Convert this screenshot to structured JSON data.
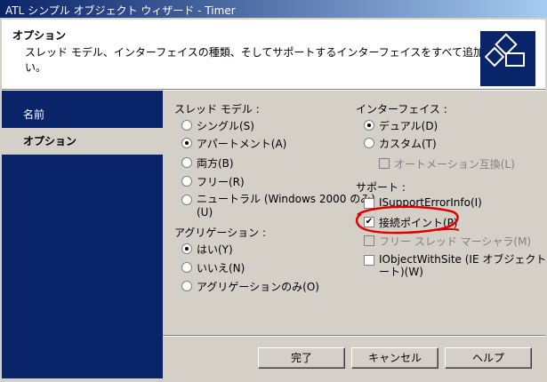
{
  "window": {
    "title": "ATL シンプル オブジェクト ウィザード - Timer"
  },
  "header": {
    "title": "オプション",
    "description": "スレッド モデル、インターフェイスの種類、そしてサポートするインターフェイスをすべて追加してください。"
  },
  "sidebar": {
    "items": [
      {
        "label": "名前",
        "active": false
      },
      {
        "label": "オプション",
        "active": true
      }
    ]
  },
  "threading": {
    "label": "スレッド モデル :",
    "options": [
      {
        "label": "シングル(S)",
        "selected": false
      },
      {
        "label": "アパートメント(A)",
        "selected": true
      },
      {
        "label": "両方(B)",
        "selected": false
      },
      {
        "label": "フリー(R)",
        "selected": false
      },
      {
        "label": "ニュートラル (Windows 2000 のみ)",
        "label2": "(U)",
        "selected": false
      }
    ]
  },
  "aggregation": {
    "label": "アグリゲーション :",
    "options": [
      {
        "label": "はい(Y)",
        "selected": true
      },
      {
        "label": "いいえ(N)",
        "selected": false
      },
      {
        "label": "アグリゲーションのみ(O)",
        "selected": false
      }
    ]
  },
  "interface": {
    "label": "インターフェイス :",
    "options": [
      {
        "label": "デュアル(D)",
        "selected": true
      },
      {
        "label": "カスタム(T)",
        "selected": false
      }
    ],
    "automation_compat": {
      "label": "オートメーション互換(L)",
      "checked": false,
      "enabled": false
    }
  },
  "support": {
    "label": "サポート :",
    "items": [
      {
        "label": "ISupportErrorInfo(I)",
        "checked": false,
        "enabled": true
      },
      {
        "label": "接続ポイント(P)",
        "checked": true,
        "enabled": true
      },
      {
        "label": "フリー スレッド マーシャラ(M)",
        "checked": false,
        "enabled": false
      },
      {
        "label": "IObjectWithSite (IE オブジェクト サポ",
        "label2": "ート)(W)",
        "checked": false,
        "enabled": true
      }
    ]
  },
  "buttons": {
    "finish": "完了",
    "cancel": "キャンセル",
    "help": "ヘルプ"
  },
  "colors": {
    "sidebar": "#0a246a",
    "annotation": "#e00000"
  }
}
